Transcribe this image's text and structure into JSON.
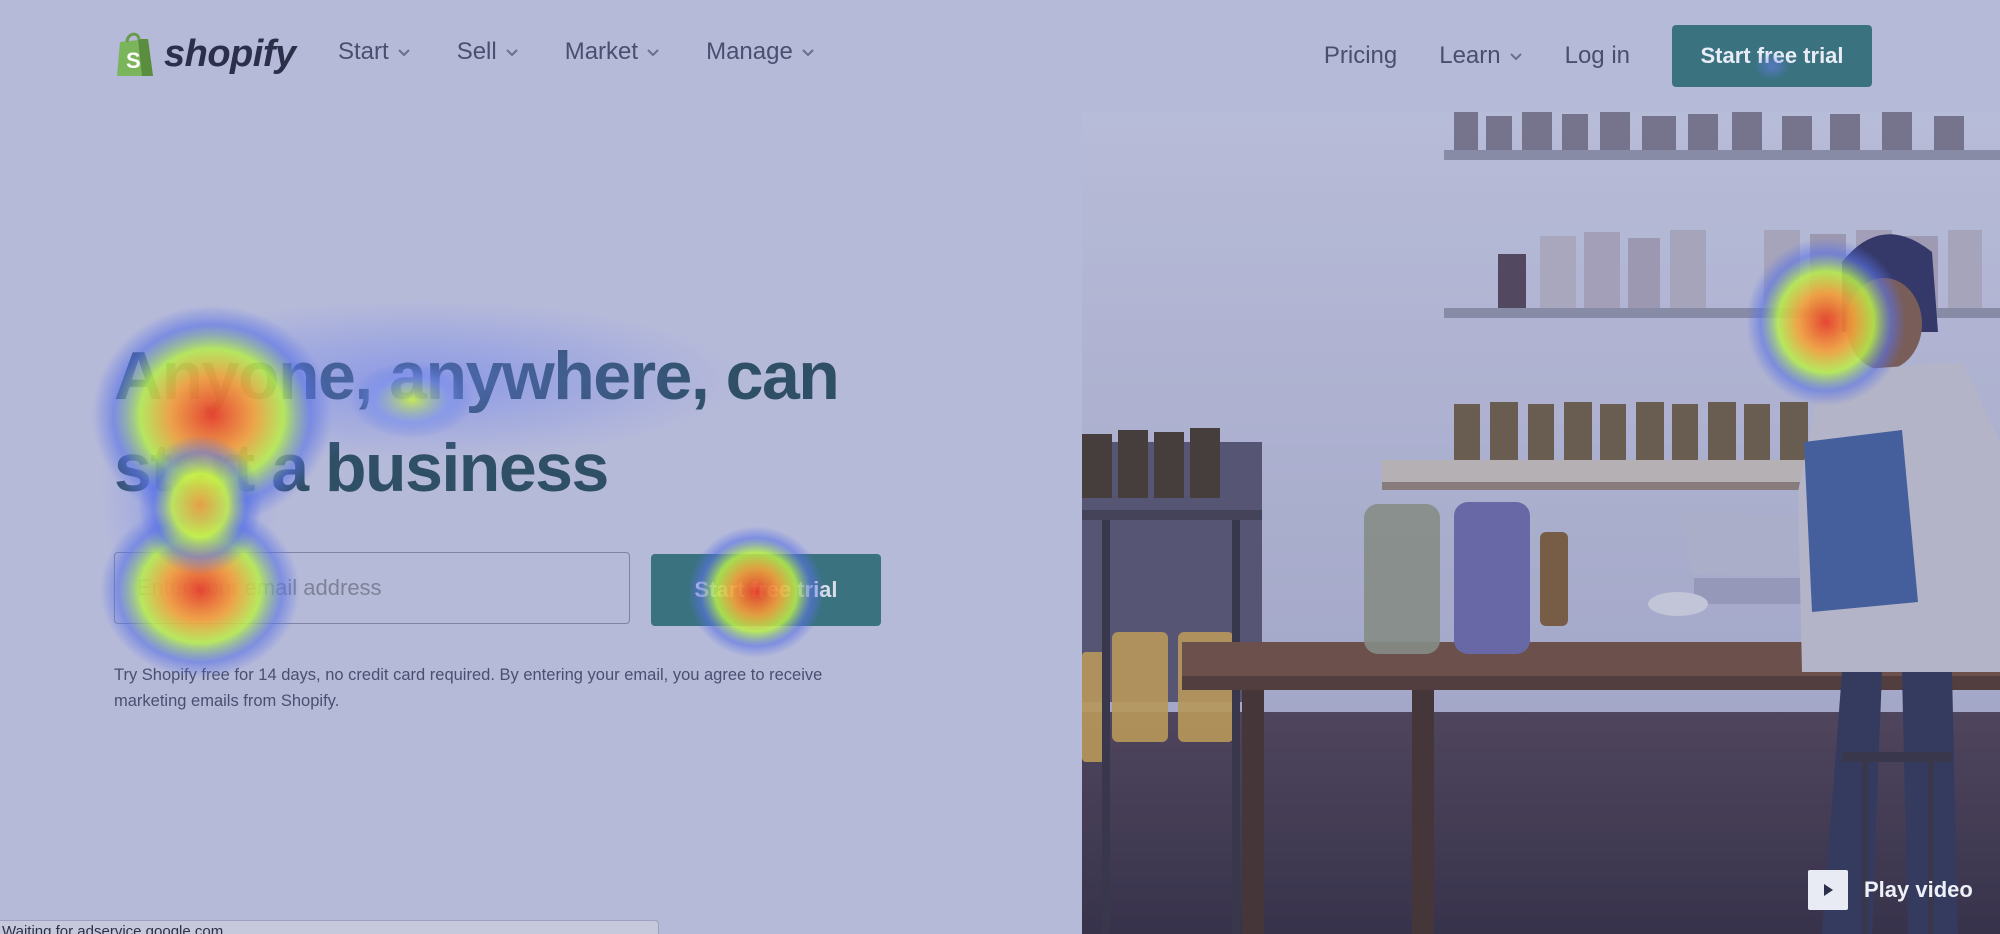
{
  "brand": {
    "logo_text": "shopify",
    "logo_icon": "shopping-bag-icon",
    "logo_color": "#7ab55c"
  },
  "nav": {
    "left_items": [
      {
        "label": "Start"
      },
      {
        "label": "Sell"
      },
      {
        "label": "Market"
      },
      {
        "label": "Manage"
      }
    ],
    "pricing": "Pricing",
    "learn": "Learn",
    "login": "Log in",
    "cta": "Start free trial"
  },
  "hero": {
    "title_line1": "Anyone, anywhere, can",
    "title_line2": "start a business",
    "email_placeholder": "Enter your email address",
    "cta": "Start free trial",
    "disclaimer_line1": "Try Shopify free for 14 days, no credit card required. By entering your email, you agree to receive",
    "disclaimer_line2": "marketing emails from Shopify."
  },
  "video": {
    "label": "Play video",
    "icon": "play-icon"
  },
  "status_bar": {
    "text": "Waiting for adservice.google.com..."
  },
  "colors": {
    "accent": "#3a7280",
    "overlay": "#b6bad9",
    "title": "#2f4f66"
  }
}
